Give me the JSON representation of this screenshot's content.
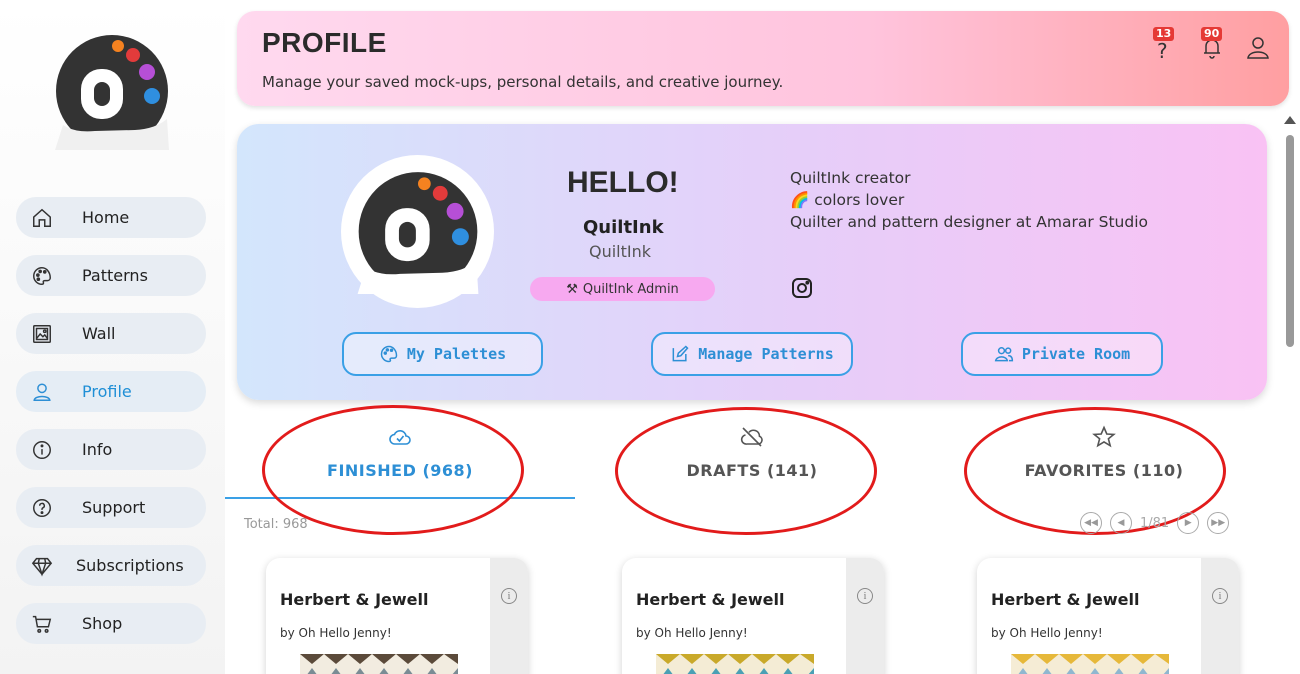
{
  "header": {
    "title": "PROFILE",
    "subtitle": "Manage your saved mock-ups, personal details, and creative journey.",
    "help_badge": "13",
    "notif_badge": "90"
  },
  "sidebar": {
    "items": [
      {
        "label": "Home",
        "icon": "home-icon"
      },
      {
        "label": "Patterns",
        "icon": "palette-icon"
      },
      {
        "label": "Wall",
        "icon": "gallery-icon"
      },
      {
        "label": "Profile",
        "icon": "user-icon",
        "active": true
      },
      {
        "label": "Info",
        "icon": "info-icon"
      },
      {
        "label": "Support",
        "icon": "help-icon"
      },
      {
        "label": "Subscriptions",
        "icon": "diamond-icon"
      },
      {
        "label": "Shop",
        "icon": "cart-icon"
      }
    ]
  },
  "profile": {
    "greeting": "HELLO!",
    "name": "QuiltInk",
    "handle": "QuiltInk",
    "role": "QuiltInk Admin",
    "bio_line1": "QuiltInk creator",
    "bio_line2": "🌈 colors lover",
    "bio_line3": "Quilter and pattern designer at Amarar Studio",
    "buttons": {
      "palettes": "My Palettes",
      "manage": "Manage Patterns",
      "private": "Private Room"
    }
  },
  "tabs": [
    {
      "label": "FINISHED (968)",
      "icon": "cloud-check-icon",
      "active": true
    },
    {
      "label": "DRAFTS (141)",
      "icon": "cloud-off-icon"
    },
    {
      "label": "FAVORITES (110)",
      "icon": "star-icon"
    }
  ],
  "list": {
    "total": "Total: 968",
    "page": "1/81"
  },
  "patterns": [
    {
      "title": "Herbert & Jewell",
      "by": "by Oh Hello Jenny!"
    },
    {
      "title": "Herbert & Jewell",
      "by": "by Oh Hello Jenny!"
    },
    {
      "title": "Herbert & Jewell",
      "by": "by Oh Hello Jenny!"
    }
  ],
  "colors": {
    "accent": "#2d8fd5",
    "badge": "#e53935",
    "annotation": "#e21b1b"
  }
}
